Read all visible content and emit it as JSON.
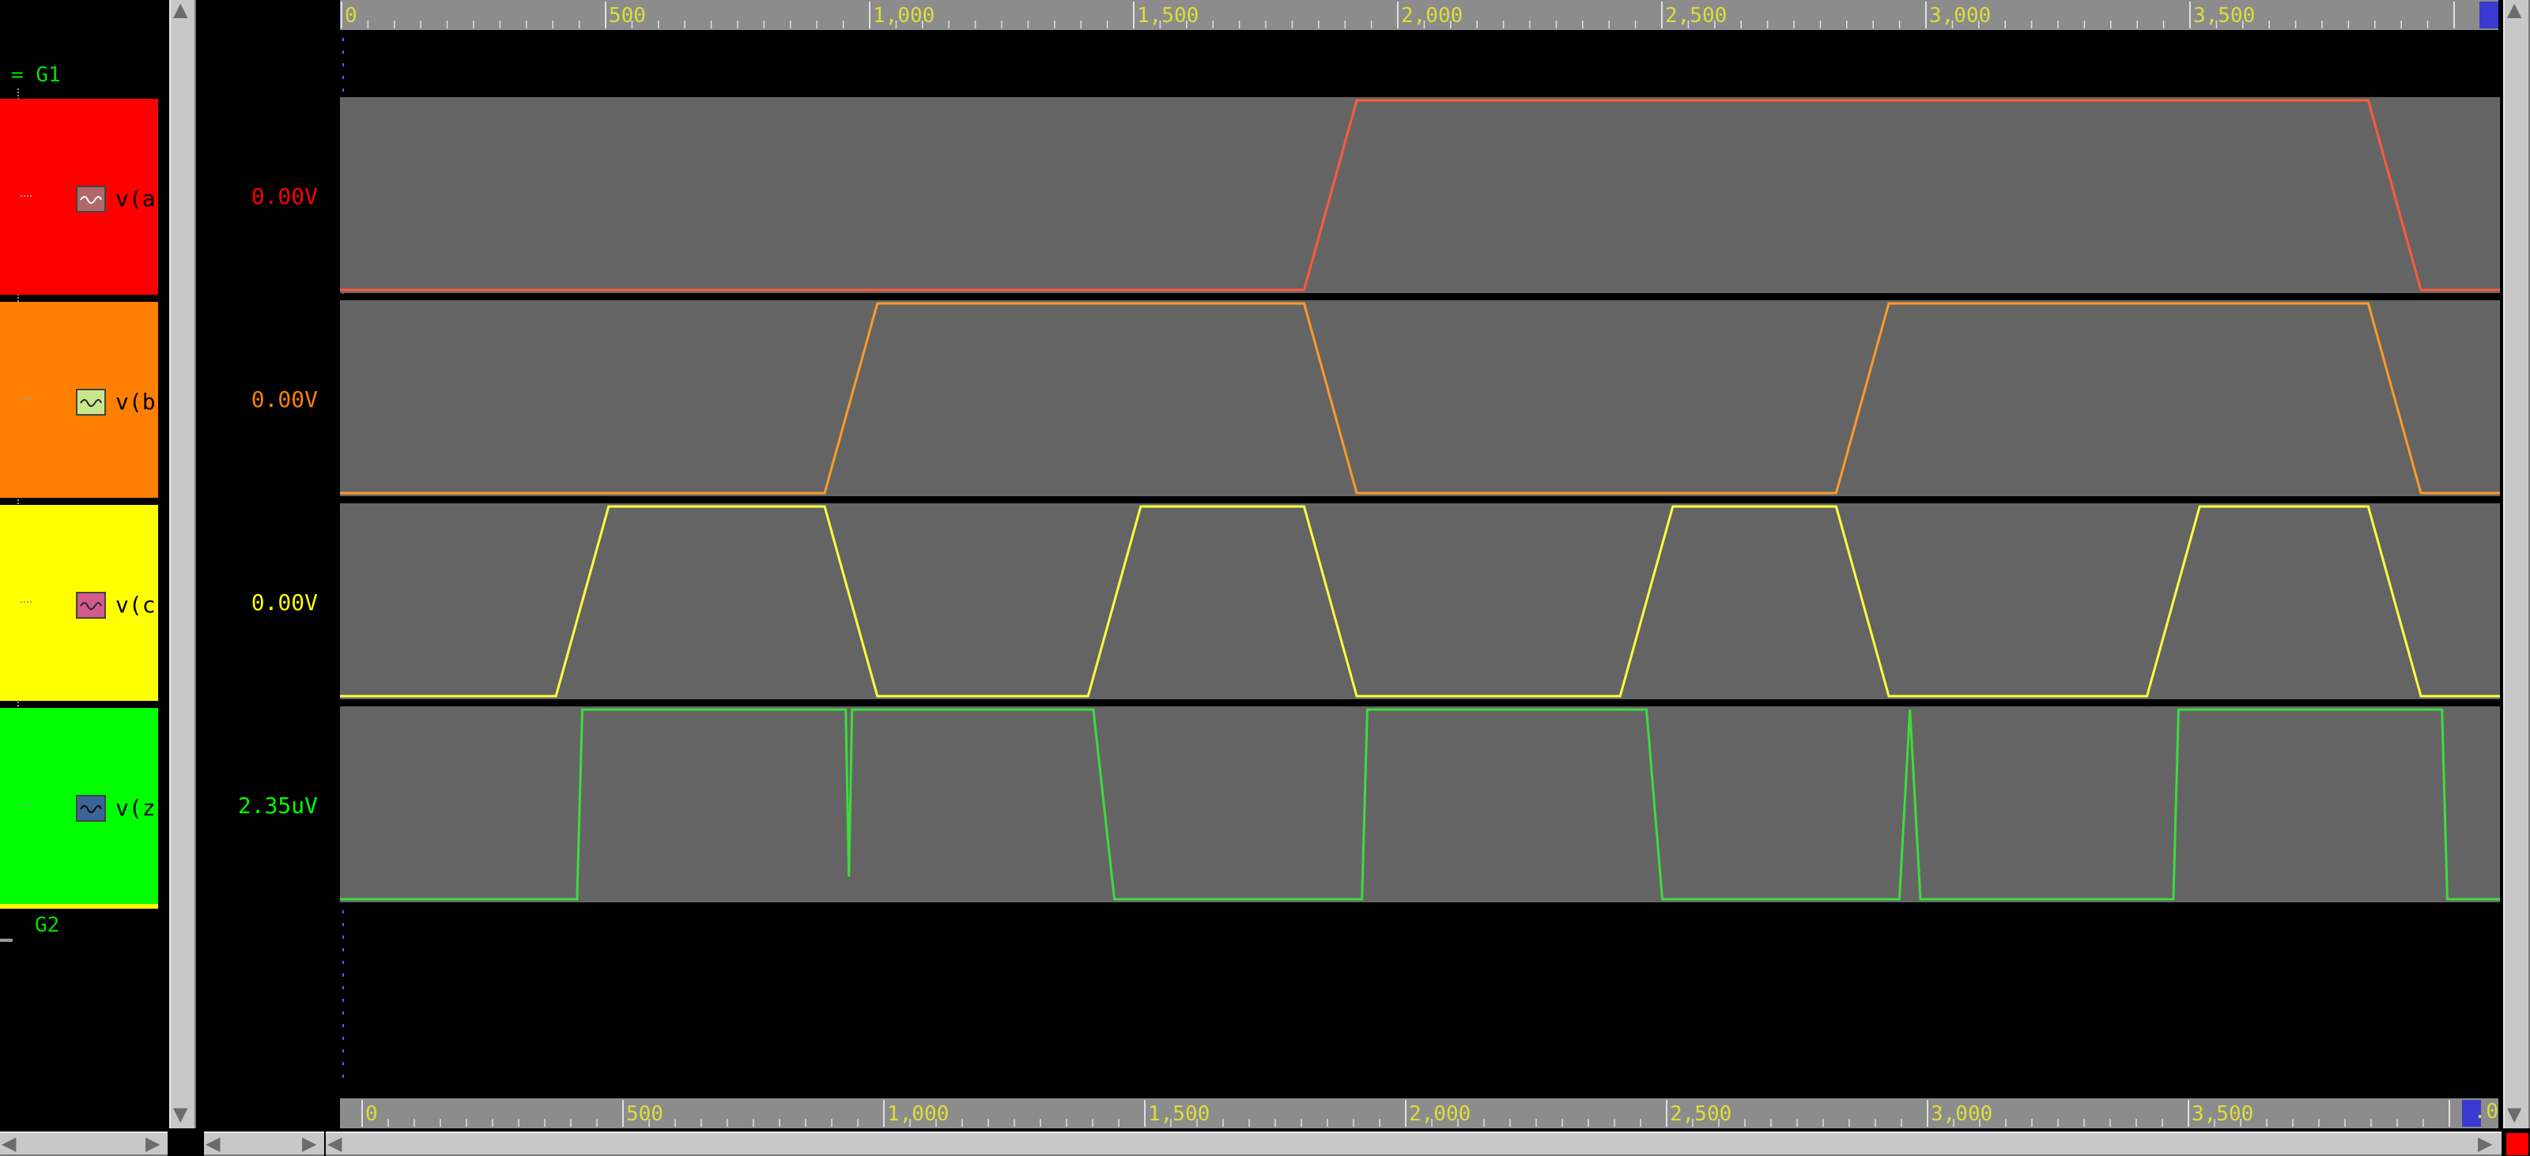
{
  "groups": [
    {
      "label": "G1",
      "marker": "="
    },
    {
      "label": "G2",
      "marker": ""
    }
  ],
  "signals": [
    {
      "name": "v(a",
      "value": "0.00V",
      "color": "#ff0000",
      "icon_color": "#b06868",
      "wave_color": "#ff5a3c"
    },
    {
      "name": "v(b",
      "value": "0.00V",
      "color": "#ff8000",
      "icon_color": "#c8e68c",
      "wave_color": "#ff9a2a"
    },
    {
      "name": "v(c",
      "value": "0.00V",
      "color": "#ffff00",
      "icon_color": "#d25a8c",
      "wave_color": "#ffff3c"
    },
    {
      "name": "v(z",
      "value": "2.35uV",
      "color": "#00ff00",
      "icon_color": "#3c6496",
      "wave_color": "#3cdc3c"
    }
  ],
  "ruler": {
    "ticks": [
      "0",
      "500",
      "1,000",
      "1,500",
      "2,000",
      "2,500",
      "3,000",
      "3,500"
    ],
    "bottom_end_label": ".0"
  },
  "time_range": [
    0,
    4100
  ],
  "waveforms": {
    "a": [
      [
        0,
        0
      ],
      [
        1830,
        0
      ],
      [
        1930,
        1
      ],
      [
        3850,
        1
      ],
      [
        3950,
        0
      ],
      [
        4100,
        0
      ]
    ],
    "b": [
      [
        0,
        0
      ],
      [
        920,
        0
      ],
      [
        1020,
        1
      ],
      [
        1830,
        1
      ],
      [
        1930,
        0
      ],
      [
        2840,
        0
      ],
      [
        2940,
        1
      ],
      [
        3850,
        1
      ],
      [
        3950,
        0
      ],
      [
        4100,
        0
      ]
    ],
    "c": [
      [
        0,
        0
      ],
      [
        410,
        0
      ],
      [
        510,
        1
      ],
      [
        920,
        1
      ],
      [
        1020,
        0
      ],
      [
        1420,
        0
      ],
      [
        1520,
        1
      ],
      [
        1830,
        1
      ],
      [
        1930,
        0
      ],
      [
        2430,
        0
      ],
      [
        2530,
        1
      ],
      [
        2840,
        1
      ],
      [
        2940,
        0
      ],
      [
        3430,
        0
      ],
      [
        3530,
        1
      ],
      [
        3850,
        1
      ],
      [
        3950,
        0
      ],
      [
        4100,
        0
      ]
    ],
    "z": [
      [
        0,
        0
      ],
      [
        450,
        0
      ],
      [
        460,
        1
      ],
      [
        960,
        1
      ],
      [
        966,
        0.12
      ],
      [
        972,
        1
      ],
      [
        1430,
        1
      ],
      [
        1470,
        0
      ],
      [
        1940,
        0
      ],
      [
        1950,
        1
      ],
      [
        2480,
        1
      ],
      [
        2510,
        0
      ],
      [
        2960,
        0
      ],
      [
        2980,
        1
      ],
      [
        3000,
        0
      ],
      [
        3480,
        0
      ],
      [
        3490,
        1
      ],
      [
        3990,
        1
      ],
      [
        4000,
        0
      ],
      [
        4100,
        0
      ]
    ]
  }
}
